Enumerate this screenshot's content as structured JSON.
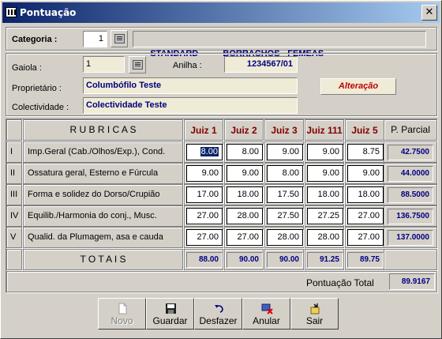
{
  "window": {
    "title": "Pontuação",
    "close_glyph": "✕"
  },
  "categoria": {
    "label": "Categoria :",
    "code": "1",
    "description": "STANDARD        - BORRACHOS - FEMEAS"
  },
  "gaiola": {
    "label": "Gaiola :",
    "code": "1"
  },
  "anilha": {
    "label": "Anilha :",
    "value": "1234567/01"
  },
  "proprietario": {
    "label": "Proprietário :",
    "value": "Columbófilo Teste"
  },
  "colectividade": {
    "label": "Colectividade :",
    "value": "Colectividade Teste"
  },
  "mode_badge": "Alteração",
  "table": {
    "rubricas_header": "R U B R I C A S",
    "judges": [
      "Juiz 1",
      "Juiz 2",
      "Juiz 3",
      "Juiz 111",
      "Juiz 5"
    ],
    "partial_header": "P. Parcial",
    "rows": [
      {
        "roman": "I",
        "rubrica": "Imp.Geral (Cab./Olhos/Exp.), Cond.",
        "scores": [
          "8.00",
          "8.00",
          "9.00",
          "9.00",
          "8.75"
        ],
        "partial": "42.7500"
      },
      {
        "roman": "II",
        "rubrica": "Ossatura geral, Esterno e Fúrcula",
        "scores": [
          "9.00",
          "9.00",
          "8.00",
          "9.00",
          "9.00"
        ],
        "partial": "44.0000"
      },
      {
        "roman": "III",
        "rubrica": "Forma e solidez do Dorso/Crupião",
        "scores": [
          "17.00",
          "18.00",
          "17.50",
          "18.00",
          "18.00"
        ],
        "partial": "88.5000"
      },
      {
        "roman": "IV",
        "rubrica": "Equilib./Harmonia do conj., Musc.",
        "scores": [
          "27.00",
          "28.00",
          "27.50",
          "27.25",
          "27.00"
        ],
        "partial": "136.7500"
      },
      {
        "roman": "V",
        "rubrica": "Qualid. da Plumagem, asa e cauda",
        "scores": [
          "27.00",
          "27.00",
          "28.00",
          "28.00",
          "27.00"
        ],
        "partial": "137.0000"
      }
    ],
    "totals_label": "T O T A I S",
    "totals": [
      "88.00",
      "90.00",
      "90.00",
      "91.25",
      "89.75"
    ],
    "total_score_label": "Pontuação Total",
    "total_score": "89.9167"
  },
  "toolbar": {
    "novo": "Novo",
    "guardar": "Guardar",
    "desfazer": "Desfazer",
    "anular": "Anular",
    "sair": "Sair"
  },
  "icons": {
    "novo": "document-icon",
    "guardar": "floppy-disk-icon",
    "desfazer": "undo-icon",
    "anular": "cancel-icon",
    "sair": "exit-icon",
    "lookup": "lookup-icon"
  }
}
